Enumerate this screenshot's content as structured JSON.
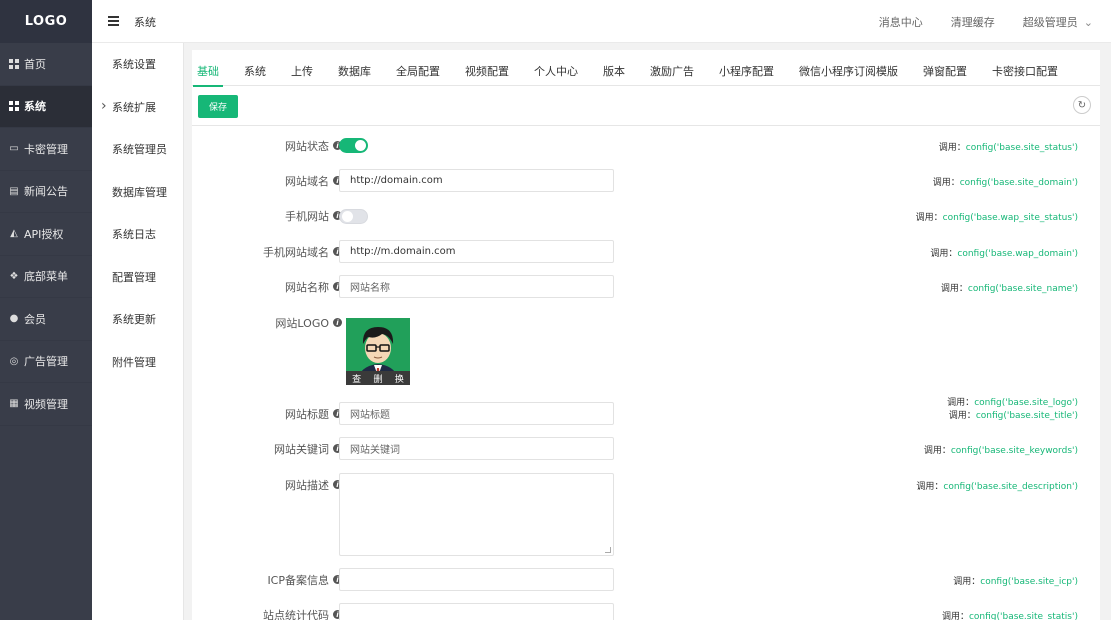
{
  "brand": {
    "logo": "LOGO"
  },
  "sidebar": {
    "items": [
      {
        "label": "首页",
        "icon": "grid-icon"
      },
      {
        "label": "系统",
        "icon": "grid-icon",
        "active": true
      },
      {
        "label": "卡密管理",
        "icon": "card-icon"
      },
      {
        "label": "新闻公告",
        "icon": "news-icon"
      },
      {
        "label": "API授权",
        "icon": "api-icon"
      },
      {
        "label": "底部菜单",
        "icon": "dropbox-icon"
      },
      {
        "label": "会员",
        "icon": "user-icon"
      },
      {
        "label": "广告管理",
        "icon": "coin-icon"
      },
      {
        "label": "视频管理",
        "icon": "video-icon"
      }
    ]
  },
  "header": {
    "breadcrumb": "系统",
    "messages": "消息中心",
    "clear_cache": "清理缓存",
    "user": "超级管理员"
  },
  "submenu": {
    "items": [
      {
        "label": "系统设置"
      },
      {
        "label": "系统扩展",
        "active": true
      },
      {
        "label": "系统管理员"
      },
      {
        "label": "数据库管理"
      },
      {
        "label": "系统日志"
      },
      {
        "label": "配置管理"
      },
      {
        "label": "系统更新"
      },
      {
        "label": "附件管理"
      }
    ]
  },
  "tabs": [
    "基础",
    "系统",
    "上传",
    "数据库",
    "全局配置",
    "视频配置",
    "个人中心",
    "版本",
    "激励广告",
    "小程序配置",
    "微信小程序订阅模版",
    "弹窗配置",
    "卡密接口配置"
  ],
  "toolbar": {
    "save": "保存",
    "refresh_icon": "refresh-icon"
  },
  "hint_prefix": "调用：",
  "form": {
    "site_status": {
      "label": "网站状态",
      "enabled": true,
      "call": "config('base.site_status')"
    },
    "site_domain": {
      "label": "网站域名",
      "value": "http://domain.com",
      "call": "config('base.site_domain')"
    },
    "wap_site_status": {
      "label": "手机网站",
      "enabled": false,
      "call": "config('base.wap_site_status')"
    },
    "wap_domain": {
      "label": "手机网站域名",
      "value": "http://m.domain.com",
      "call": "config('base.wap_domain')"
    },
    "site_name": {
      "label": "网站名称",
      "placeholder": "网站名称",
      "call": "config('base.site_name')"
    },
    "site_logo": {
      "label": "网站LOGO",
      "actions": [
        "查",
        "删",
        "换"
      ],
      "call": "config('base.site_logo')"
    },
    "site_title": {
      "label": "网站标题",
      "placeholder": "网站标题",
      "call": "config('base.site_title')"
    },
    "site_keywords": {
      "label": "网站关键词",
      "placeholder": "网站关键词",
      "call": "config('base.site_keywords')"
    },
    "site_description": {
      "label": "网站描述",
      "call": "config('base.site_description')"
    },
    "site_icp": {
      "label": "ICP备案信息",
      "call": "config('base.site_icp')"
    },
    "site_statis": {
      "label": "站点统计代码",
      "call": "config('base.site_statis')"
    }
  },
  "colors": {
    "accent": "#16b777",
    "sidebar": "#393d49"
  }
}
